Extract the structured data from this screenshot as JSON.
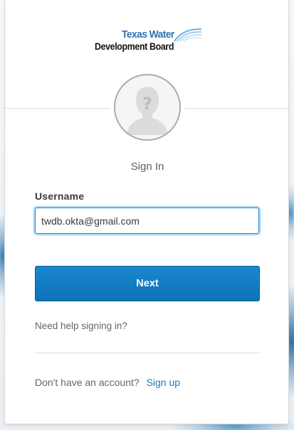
{
  "logo": {
    "line1": "Texas Water",
    "line2": "Development Board"
  },
  "form": {
    "heading": "Sign In",
    "username_label": "Username",
    "username_value": "twdb.okta@gmail.com",
    "next_label": "Next",
    "help_link": "Need help signing in?",
    "no_account_text": "Don't have an account?",
    "signup_link": "Sign up"
  },
  "colors": {
    "primary": "#0e73b9",
    "link": "#1a7abf",
    "logo_blue": "#2f74b5",
    "focus_ring": "#2e8ccf"
  },
  "icons": {
    "avatar": "user-placeholder-icon",
    "logo_wave": "water-wave-icon"
  }
}
